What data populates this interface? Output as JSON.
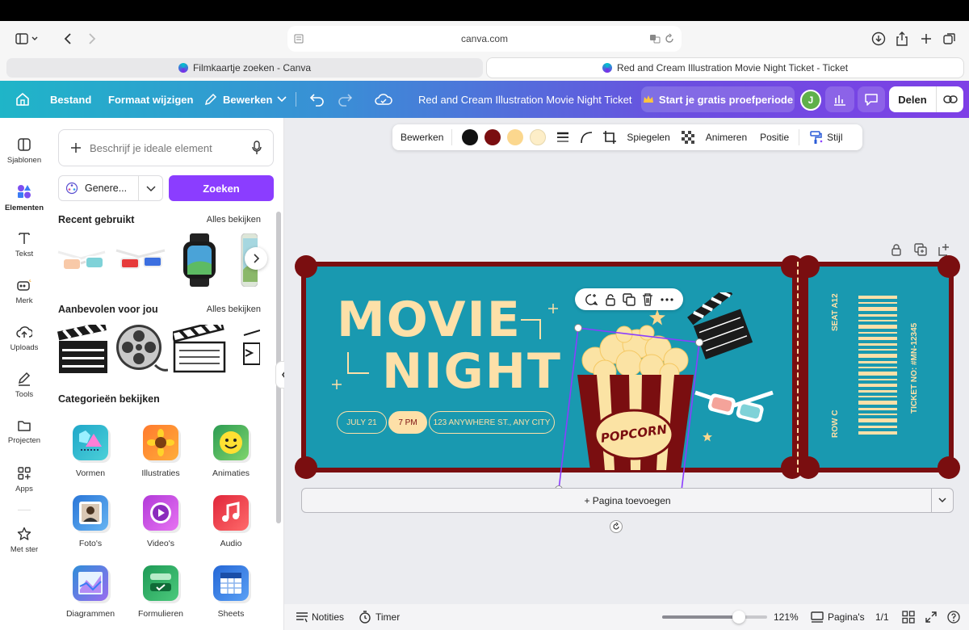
{
  "browser": {
    "url": "canva.com",
    "tabs": [
      {
        "label": "Filmkaartje zoeken - Canva",
        "active": false
      },
      {
        "label": "Red and Cream Illustration Movie Night Ticket - Ticket",
        "active": true
      }
    ]
  },
  "header": {
    "file": "Bestand",
    "resize": "Formaat wijzigen",
    "edit": "Bewerken",
    "doc_title": "Red and Cream Illustration Movie Night Ticket",
    "trial": "Start je gratis proefperiode",
    "avatar": "J",
    "share": "Delen"
  },
  "rail": [
    {
      "label": "Sjablonen",
      "icon": "layout-icon"
    },
    {
      "label": "Elementen",
      "icon": "elements-icon"
    },
    {
      "label": "Tekst",
      "icon": "text-icon"
    },
    {
      "label": "Merk",
      "icon": "brand-icon"
    },
    {
      "label": "Uploads",
      "icon": "upload-icon"
    },
    {
      "label": "Tools",
      "icon": "pen-icon"
    },
    {
      "label": "Projecten",
      "icon": "folder-icon"
    },
    {
      "label": "Apps",
      "icon": "apps-icon"
    },
    {
      "label": "Met ster",
      "icon": "star-icon"
    }
  ],
  "panel": {
    "search_placeholder": "Beschrijf je ideale element",
    "generate_label": "Genere...",
    "search_button": "Zoeken",
    "recent_title": "Recent gebruikt",
    "recent_link": "Alles bekijken",
    "recommended_title": "Aanbevolen voor jou",
    "recommended_link": "Alles bekijken",
    "categories_title": "Categorieën bekijken",
    "categories": [
      {
        "label": "Vormen"
      },
      {
        "label": "Illustraties"
      },
      {
        "label": "Animaties"
      },
      {
        "label": "Foto's"
      },
      {
        "label": "Video's"
      },
      {
        "label": "Audio"
      },
      {
        "label": "Diagrammen"
      },
      {
        "label": "Formulieren"
      },
      {
        "label": "Sheets"
      }
    ]
  },
  "context_toolbar": {
    "edit": "Bewerken",
    "colors": [
      "#111111",
      "#7a0e10",
      "#fbd78e",
      "#fdeec8"
    ],
    "flip": "Spiegelen",
    "animate": "Animeren",
    "position": "Positie",
    "style": "Stijl"
  },
  "ticket": {
    "title_line1": "MOVIE",
    "title_line2": "NIGHT",
    "date": "JULY 21",
    "time": "7 PM",
    "address": "123 ANYWHERE ST., ANY CITY",
    "seat": "SEAT A12",
    "row": "ROW C",
    "ticket_no": "TICKET NO: #MN-12345",
    "popcorn_label": "POPCORN",
    "colors": {
      "maroon": "#7a0e10",
      "teal": "#1999b0",
      "cream": "#fde0a8"
    }
  },
  "add_page": "+ Pagina toevoegen",
  "bottom": {
    "notes": "Notities",
    "timer": "Timer",
    "zoom": "121%",
    "zoom_fraction": 0.73,
    "pages_label": "Pagina's",
    "page_count": "1/1"
  }
}
